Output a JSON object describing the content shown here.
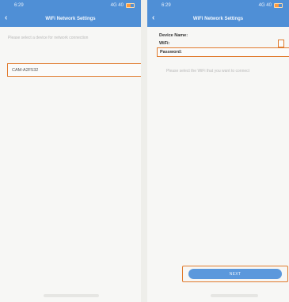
{
  "left_screen": {
    "status": {
      "time": "6:29",
      "signal": "4G 40"
    },
    "nav": {
      "title": "WiFi Network Settings",
      "back_icon": "chevron-left-icon"
    },
    "hint": "Please select a device for network connection",
    "device": {
      "name": "CAM-A2F532",
      "icon": "wifi-lock-icon"
    }
  },
  "right_screen": {
    "status": {
      "time": "6:29",
      "signal": "4G 40"
    },
    "nav": {
      "title": "WiFi Network Settings",
      "back_icon": "chevron-left-icon"
    },
    "form": {
      "device_name_label": "Device Name:",
      "device_name_value": "",
      "wifi_label": "WiFi:",
      "wifi_value": "",
      "password_label": "Password:",
      "password_placeholder": ""
    },
    "hint": "Please select the WiFi that you want to connect",
    "next_label": "NEXT"
  },
  "colors": {
    "header_blue": "#4f8fd6",
    "highlight_orange": "#e07a2c",
    "button_blue": "#5b98dc"
  }
}
